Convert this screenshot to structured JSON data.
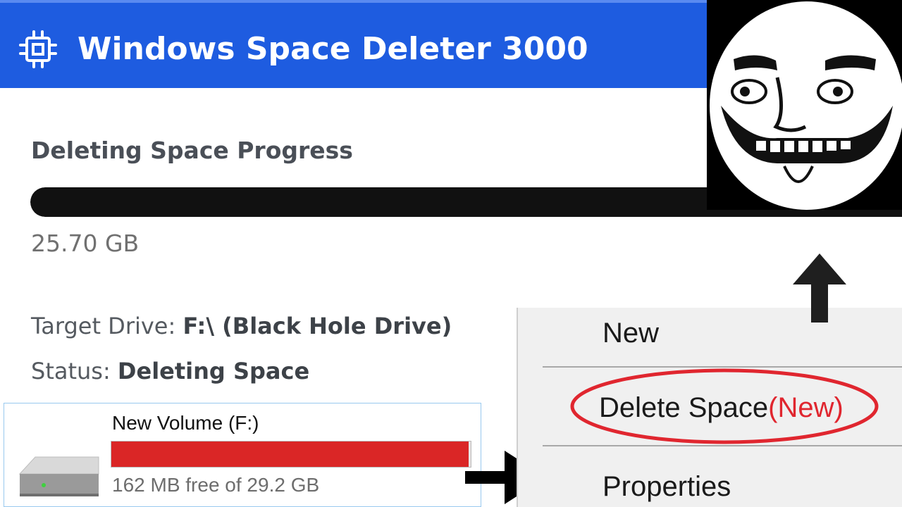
{
  "window": {
    "title": "Windows Space Deleter 3000",
    "title_icon": "cpu-chip-icon",
    "accent_color": "#1e5ce0"
  },
  "progress": {
    "label": "Deleting Space Progress",
    "fraction": 1.0,
    "value_text": "25.70 GB"
  },
  "info": {
    "target_label": "Target Drive:",
    "target_value": "F:\\ (Black Hole Drive)",
    "status_label": "Status:",
    "status_value": "Deleting Space"
  },
  "drive": {
    "name": "New Volume (F:)",
    "used_fraction": 0.995,
    "free_text": "162 MB free of 29.2 GB",
    "bar_color": "#da2626",
    "icon": "hard-drive-icon"
  },
  "context_menu": {
    "items": [
      {
        "label": "New"
      },
      {
        "label": "Delete Space",
        "badge": "(New)"
      },
      {
        "label": "Properties"
      }
    ],
    "badge_color": "#e0262f",
    "highlight_color": "#e0262f"
  },
  "decorations": {
    "arrow_right_icon": "arrow-right-icon",
    "arrow_up_icon": "arrow-up-icon",
    "meme_image": "troll-face-image"
  }
}
